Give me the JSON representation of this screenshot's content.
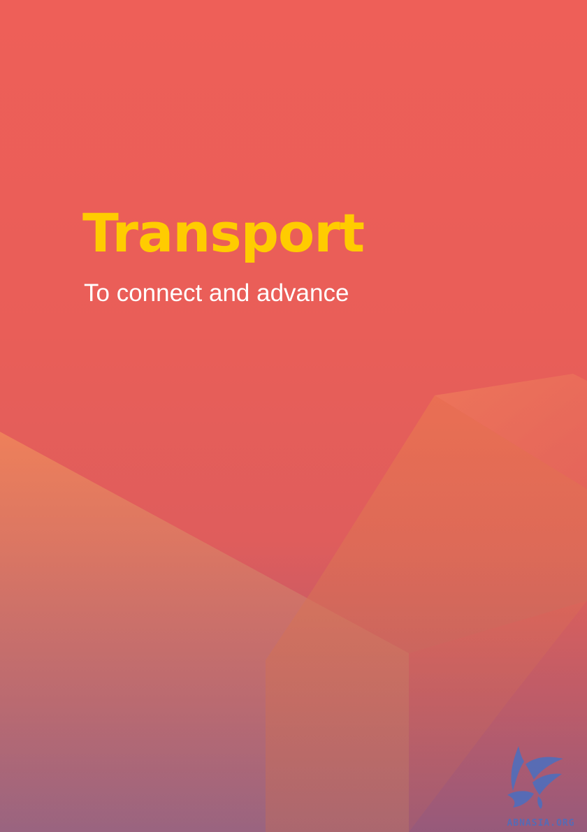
{
  "cover": {
    "title": "Transport",
    "subtitle": "To connect and advance"
  },
  "logo": {
    "text": "ABNASIA.ORG"
  },
  "colors": {
    "background": "#ee5f58",
    "title": "#ffcc00",
    "subtitle": "#ffffff",
    "shape_orange": "#f08a55",
    "logo": "#4a6fc0"
  }
}
